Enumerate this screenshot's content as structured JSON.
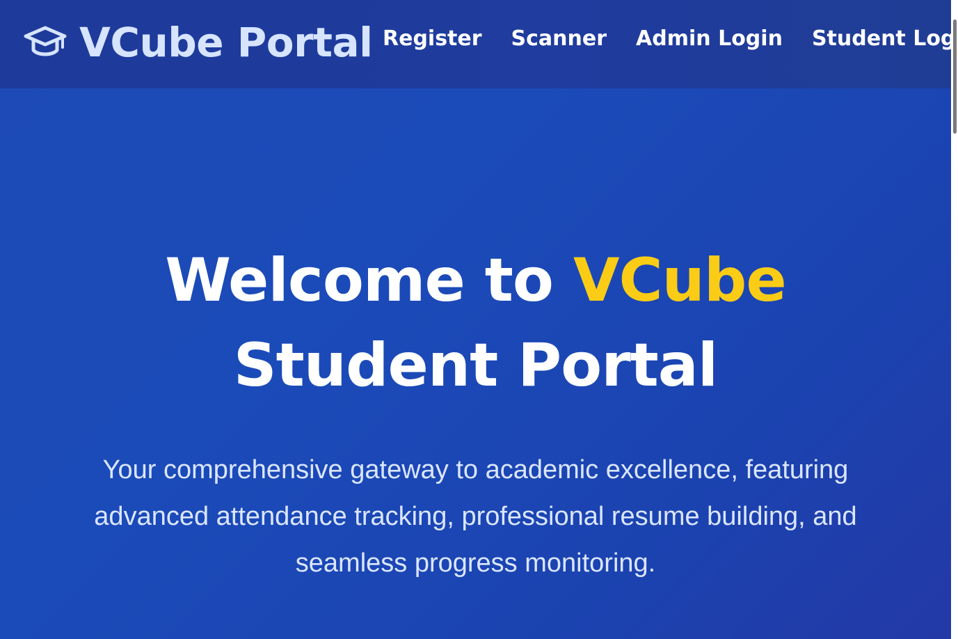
{
  "navbar": {
    "brand_icon": "graduation-cap-icon",
    "brand_name": "VCube Portal",
    "links": [
      {
        "label": "Register"
      },
      {
        "label": "Scanner"
      },
      {
        "label": "Admin Login"
      },
      {
        "label": "Student Login"
      }
    ]
  },
  "hero": {
    "title_prefix": "Welcome to ",
    "title_accent": "VCube",
    "title_line2": "Student Portal",
    "subtitle": "Your comprehensive gateway to academic excellence, featuring advanced attendance tracking, professional resume building, and seamless progress monitoring."
  },
  "colors": {
    "navbar_bg": "#1e3a9a",
    "hero_bg": "#1b4bb9",
    "accent": "#facc15",
    "brand_text": "#d6e4ff"
  }
}
